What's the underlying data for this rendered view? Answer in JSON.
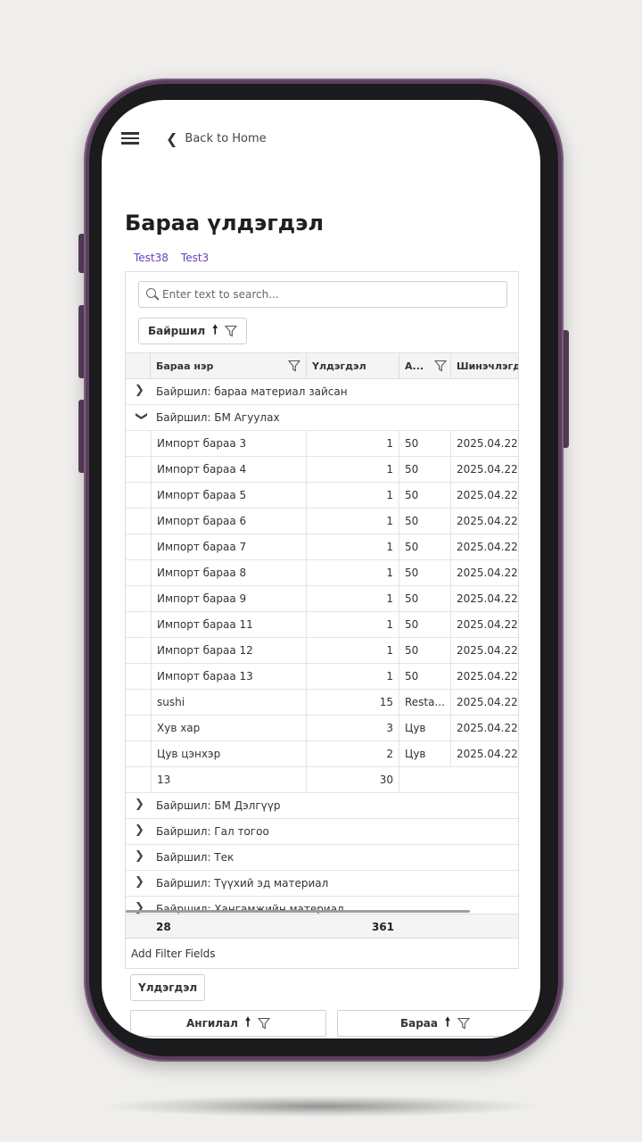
{
  "header": {
    "back_label": "Back to Home"
  },
  "page": {
    "title": "Бараа үлдэгдэл",
    "tabs": [
      "Test38",
      "Test3"
    ]
  },
  "grid": {
    "search_placeholder": "Enter text to search...",
    "group_chip": "Байршил",
    "columns": [
      "Бараа нэр",
      "Үлдэгдэл",
      "А...",
      "Шинэчлэгд"
    ],
    "groups_top": [
      {
        "label": "Байршил: бараа материал зайсан",
        "expanded": false
      },
      {
        "label": "Байршил: БМ Агуулах",
        "expanded": true
      }
    ],
    "rows": [
      {
        "name": "Импорт бараа 3",
        "qty": "1",
        "cat": "50",
        "date": "2025.04.22"
      },
      {
        "name": "Импорт бараа 4",
        "qty": "1",
        "cat": "50",
        "date": "2025.04.22"
      },
      {
        "name": "Импорт бараа 5",
        "qty": "1",
        "cat": "50",
        "date": "2025.04.22"
      },
      {
        "name": "Импорт бараа 6",
        "qty": "1",
        "cat": "50",
        "date": "2025.04.22"
      },
      {
        "name": "Импорт бараа 7",
        "qty": "1",
        "cat": "50",
        "date": "2025.04.22"
      },
      {
        "name": "Импорт бараа 8",
        "qty": "1",
        "cat": "50",
        "date": "2025.04.22"
      },
      {
        "name": "Импорт бараа 9",
        "qty": "1",
        "cat": "50",
        "date": "2025.04.22"
      },
      {
        "name": "Импорт бараа 11",
        "qty": "1",
        "cat": "50",
        "date": "2025.04.22"
      },
      {
        "name": "Импорт бараа 12",
        "qty": "1",
        "cat": "50",
        "date": "2025.04.22"
      },
      {
        "name": "Импорт бараа 13",
        "qty": "1",
        "cat": "50",
        "date": "2025.04.22"
      },
      {
        "name": "sushi",
        "qty": "15",
        "cat": "Resta...",
        "date": "2025.04.22"
      },
      {
        "name": "Хув хар",
        "qty": "3",
        "cat": "Цув",
        "date": "2025.04.22"
      },
      {
        "name": "Цув цэнхэр",
        "qty": "2",
        "cat": "Цув",
        "date": "2025.04.22"
      }
    ],
    "group_summary": {
      "count": "13",
      "qty": "30"
    },
    "groups_bottom": [
      "Байршил: БМ Дэлгүүр",
      "Байршил: Гал тогоо",
      "Байршил: Тек",
      "Байршил: Түүхий эд материал",
      "Байршил: Хангамжийн материал"
    ],
    "total": {
      "count": "28",
      "qty": "361"
    }
  },
  "pivot": {
    "filter_label": "Add Filter Fields",
    "data_field": "Үлдэгдэл",
    "row_fields": [
      "Ангилал",
      "Бараа"
    ]
  }
}
